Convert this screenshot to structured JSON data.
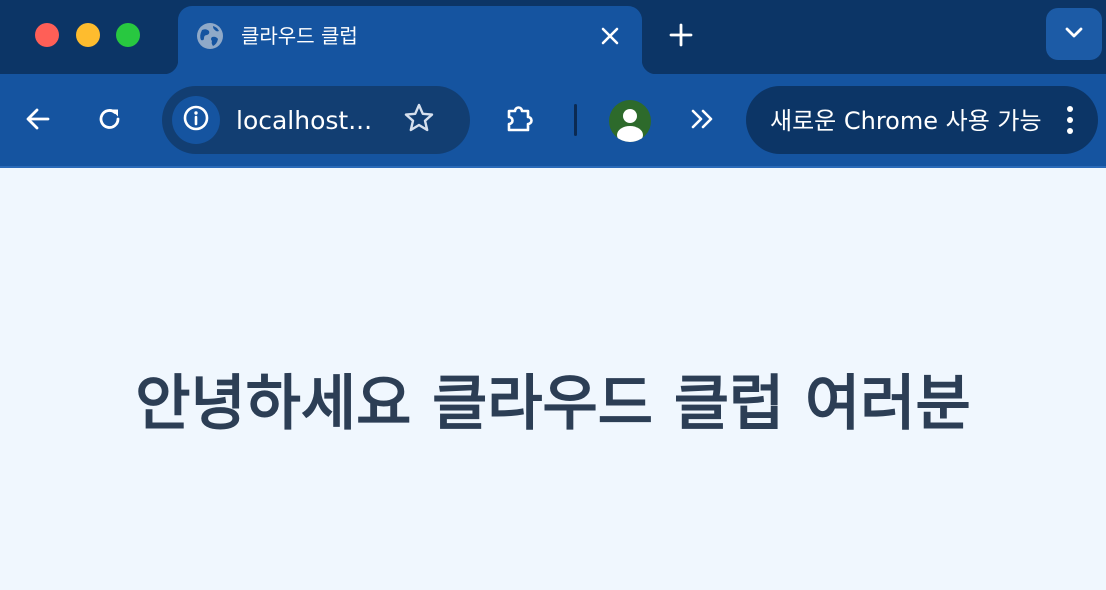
{
  "window": {
    "controls": [
      "close",
      "minimize",
      "maximize"
    ]
  },
  "tab": {
    "title": "클라우드 클럽",
    "favicon": "globe-icon"
  },
  "toolbar": {
    "url": "localhost...",
    "update_label": "새로운 Chrome 사용 가능"
  },
  "page": {
    "headline": "안녕하세요 클라우드 클럽 여러분"
  },
  "colors": {
    "tabstrip": "#0c3566",
    "toolbar": "#1554a0",
    "page_background": "#f0f7fe",
    "headline_text": "#2c3e55"
  },
  "icons": [
    "globe-icon",
    "close-icon",
    "plus-icon",
    "chevron-down-icon",
    "arrow-left-icon",
    "reload-icon",
    "info-icon",
    "star-icon",
    "puzzle-icon",
    "avatar-icon",
    "chevron-double-right-icon",
    "more-vertical-icon"
  ]
}
